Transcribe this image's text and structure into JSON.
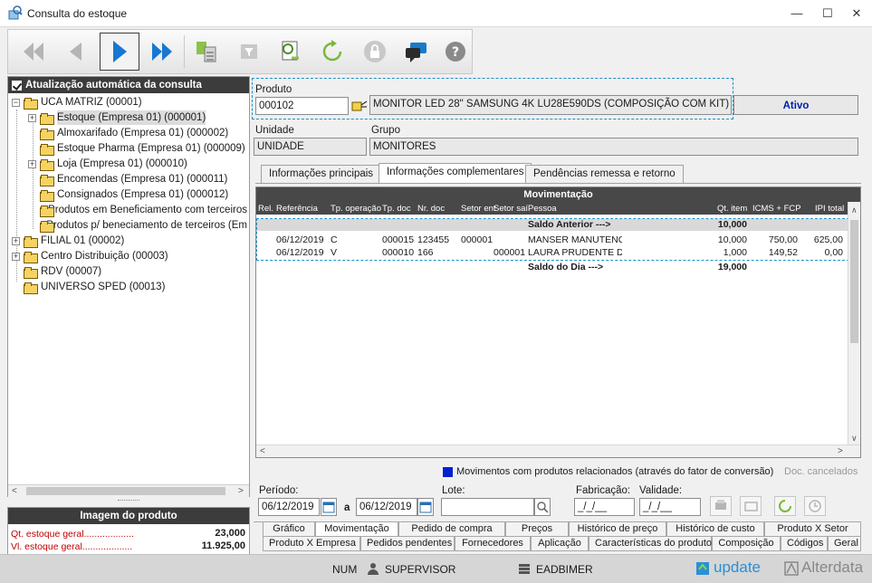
{
  "window": {
    "title": "Consulta do estoque"
  },
  "toolbar": {
    "icons": [
      "first-icon",
      "prev-icon",
      "next-icon",
      "last-icon",
      "export-icon",
      "filter-icon",
      "search-doc-icon",
      "refresh-icon",
      "lock-icon",
      "chat-icon",
      "help-icon"
    ]
  },
  "tree": {
    "header": "Atualização automática da consulta",
    "items": [
      {
        "label": "UCA MATRIZ (00001)"
      },
      {
        "label": "Estoque (Empresa 01) (000001)"
      },
      {
        "label": "Almoxarifado (Empresa 01) (000002)"
      },
      {
        "label": "Estoque Pharma (Empresa 01) (000009)"
      },
      {
        "label": "Loja (Empresa 01) (000010)"
      },
      {
        "label": "Encomendas (Empresa 01) (000011)"
      },
      {
        "label": "Consignados (Empresa 01) (000012)"
      },
      {
        "label": "Produtos em Beneficiamento com terceiros"
      },
      {
        "label": "Produtos p/ beneciamento de terceiros (Em"
      },
      {
        "label": "FILIAL 01 (00002)"
      },
      {
        "label": "Centro Distribuição (00003)"
      },
      {
        "label": "RDV (00007)"
      },
      {
        "label": "UNIVERSO SPED (00013)"
      }
    ]
  },
  "image_panel": {
    "header": "Imagem do produto",
    "qt_label": "Qt. estoque geral...................",
    "qt_value": "23,000",
    "vl_label": "Vl. estoque geral...................",
    "vl_value": "11.925,00"
  },
  "product": {
    "label": "Produto",
    "code": "000102",
    "description": "MONITOR LED 28\" SAMSUNG 4K LU28E590DS (COMPOSIÇÃO COM KIT)",
    "status": "Ativo",
    "unidade_label": "Unidade",
    "unidade": "UNIDADE",
    "grupo_label": "Grupo",
    "grupo": "MONITORES"
  },
  "tabs": [
    "Informações principais",
    "Informações complementares",
    "Pendências remessa e retorno"
  ],
  "grid": {
    "title": "Movimentação",
    "headers": [
      "Rel.",
      "Referência",
      "Tp. operação",
      "Tp. doc",
      "Nr. doc",
      "Setor ent",
      "Setor saí",
      "Pessoa",
      "Qt. item",
      "ICMS + FCP",
      "IPI total"
    ],
    "saldo_anterior_label": "Saldo Anterior --->",
    "saldo_anterior_value": "10,000",
    "rows": [
      {
        "ref": "06/12/2019",
        "tp_op": "C",
        "tp_doc": "000015",
        "nr_doc": "123455",
        "setor_ent": "000001",
        "setor_sai": "",
        "pessoa": "MANSER MANUTENC",
        "qt": "10,000",
        "icms": "750,00",
        "ipi": "625,00"
      },
      {
        "ref": "06/12/2019",
        "tp_op": "V",
        "tp_doc": "000010",
        "nr_doc": "166",
        "setor_ent": "",
        "setor_sai": "000001",
        "pessoa": "LAURA PRUDENTE D",
        "qt": "1,000",
        "icms": "149,52",
        "ipi": "0,00"
      }
    ],
    "saldo_dia_label": "Saldo do Dia --->",
    "saldo_dia_value": "19,000"
  },
  "legend": {
    "text": "Movimentos com produtos relacionados (através do fator de conversão)",
    "cancel_text": "Doc. cancelados",
    "color": "#0022cc"
  },
  "filters": {
    "periodo_label": "Período:",
    "date_from": "06/12/2019",
    "a_label": "a",
    "date_to": "06/12/2019",
    "lote_label": "Lote:",
    "fabricacao_label": "Fabricação:",
    "fabricacao_value": "_/_/__",
    "validade_label": "Validade:",
    "validade_value": "_/_/__"
  },
  "bottom_tabs_row1": [
    "Gráfico",
    "Movimentação",
    "Pedido de compra",
    "Preços",
    "Histórico de preço",
    "Histórico de custo",
    "Produto X Setor"
  ],
  "bottom_tabs_row2": [
    "Produto X Empresa",
    "Pedidos pendentes",
    "Fornecedores",
    "Aplicação",
    "Características do produto",
    "Composição",
    "Códigos",
    "Geral"
  ],
  "statusbar": {
    "num": "NUM",
    "user": "SUPERVISOR",
    "db": "EADBIMER",
    "brand1": "update",
    "brand2": "Alterdata"
  }
}
